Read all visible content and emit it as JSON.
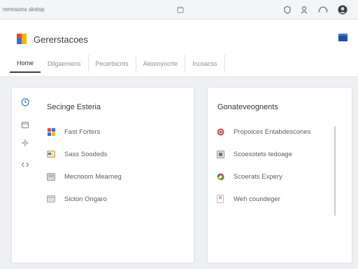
{
  "window": {
    "title": "mmnsons skstsp"
  },
  "header": {
    "app_title": "Gererstacoes",
    "tabs": [
      {
        "label": "Home",
        "active": true
      },
      {
        "label": "Dilgaemens",
        "active": false
      },
      {
        "label": "Pecerbicnts",
        "active": false
      },
      {
        "label": "Aiioonyocrte",
        "active": false
      },
      {
        "label": "Incoacss",
        "active": false
      }
    ]
  },
  "left_panel": {
    "title": "Secinge Esteria",
    "rail_icons": [
      "clock-icon",
      "calendar-icon",
      "settings-icon",
      "code-icon"
    ],
    "items": [
      {
        "label": "Fast Forters",
        "icon": "palette-icon"
      },
      {
        "label": "Sass Soodeds",
        "icon": "card-icon"
      },
      {
        "label": "Mecrioom Mearneg",
        "icon": "monitor-icon"
      },
      {
        "label": "Sicton Ongaro",
        "icon": "window-icon"
      }
    ]
  },
  "right_panel": {
    "title": "Gonateveognents",
    "items": [
      {
        "label": "Propoices Entabdescones",
        "icon": "chrome-icon"
      },
      {
        "label": "Scoesotets tedoage",
        "icon": "square-icon"
      },
      {
        "label": "Scoerats Expery",
        "icon": "google-icon"
      },
      {
        "label": "Weh coundeger",
        "icon": "document-icon"
      }
    ]
  },
  "colors": {
    "accent": "#1f4fa8",
    "background": "#eef0f4"
  }
}
